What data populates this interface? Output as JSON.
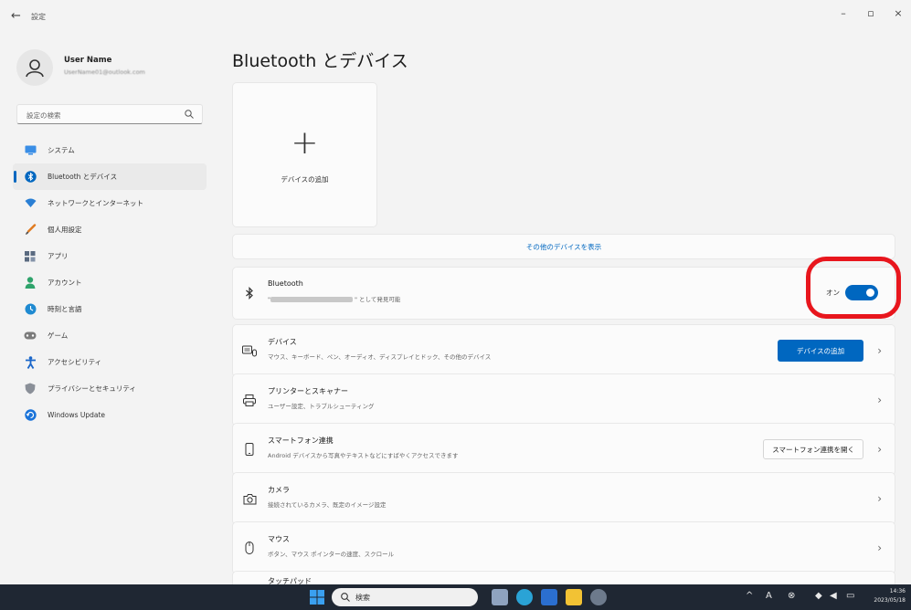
{
  "window": {
    "title": "設定",
    "minimize_glyph": "–",
    "maximize_glyph": "▫",
    "close_glyph": "×"
  },
  "sidebar": {
    "user_name": "User Name",
    "user_email": "UserName01@outlook.com",
    "search_placeholder": "設定の検索",
    "items": [
      {
        "label": "システム",
        "icon": "display-icon",
        "color": "#3a8ee6"
      },
      {
        "label": "Bluetooth とデバイス",
        "icon": "bluetooth-icon",
        "color": "#0067c0"
      },
      {
        "label": "ネットワークとインターネット",
        "icon": "wifi-icon",
        "color": "#2a7fd4"
      },
      {
        "label": "個人用設定",
        "icon": "brush-icon",
        "color": "#e07a1f"
      },
      {
        "label": "アプリ",
        "icon": "apps-icon",
        "color": "#5a6a80"
      },
      {
        "label": "アカウント",
        "icon": "person-icon",
        "color": "#2fa36b"
      },
      {
        "label": "時刻と言語",
        "icon": "globe-clock-icon",
        "color": "#1f8ad1"
      },
      {
        "label": "ゲーム",
        "icon": "gamepad-icon",
        "color": "#7a7a7a"
      },
      {
        "label": "アクセシビリティ",
        "icon": "accessibility-icon",
        "color": "#1a66c9"
      },
      {
        "label": "プライバシーとセキュリティ",
        "icon": "shield-icon",
        "color": "#8a8f98"
      },
      {
        "label": "Windows Update",
        "icon": "update-icon",
        "color": "#1a73d9"
      }
    ]
  },
  "main": {
    "title": "Bluetooth とデバイス",
    "add_device_card_label": "デバイスの追加",
    "show_more_label": "その他のデバイスを表示",
    "bluetooth": {
      "title": "Bluetooth",
      "subtitle_suffix": "\" として発見可能",
      "state_label": "オン",
      "on": true
    },
    "rows": {
      "devices": {
        "title": "デバイス",
        "subtitle": "マウス、キーボード、ペン、オーディオ、ディスプレイとドック、その他のデバイス",
        "button": "デバイスの追加"
      },
      "printers": {
        "title": "プリンターとスキャナー",
        "subtitle": "ユーザー設定、トラブルシューティング"
      },
      "phone": {
        "title": "スマートフォン連携",
        "subtitle": "Android デバイスから写真やテキストなどにすばやくアクセスできます",
        "button": "スマートフォン連携を開く"
      },
      "camera": {
        "title": "カメラ",
        "subtitle": "接続されているカメラ、既定のイメージ設定"
      },
      "mouse": {
        "title": "マウス",
        "subtitle": "ボタン、マウス ポインターの速度、スクロール"
      },
      "touchpad": {
        "title": "タッチパッド"
      }
    }
  },
  "taskbar": {
    "search_label": "検索",
    "clock_time": "14:36",
    "clock_date": "2023/05/18"
  },
  "colors": {
    "accent": "#0067c0",
    "highlight": "#e8161d"
  }
}
